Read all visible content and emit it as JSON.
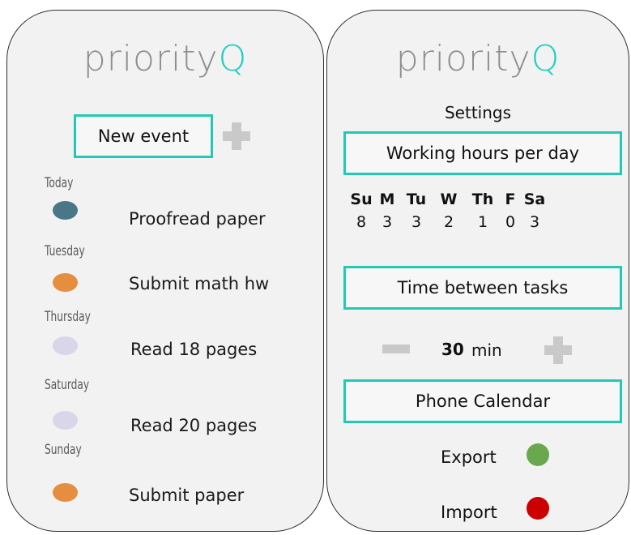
{
  "colors": {
    "accent": "#23c9b4",
    "logo_gray": "#8f8f8f",
    "plus_gray": "#c9c9c9",
    "export_green": "#6aa84f",
    "import_red": "#cc0000"
  },
  "left": {
    "logo": {
      "main": "priority",
      "accent": "Q"
    },
    "new_event_label": "New event",
    "add_icon": "plus-icon",
    "events": [
      {
        "day": "Today",
        "task": "Proofread paper",
        "color": "#4a7787"
      },
      {
        "day": "Tuesday",
        "task": "Submit math hw",
        "color": "#e58e3f"
      },
      {
        "day": "Thursday",
        "task": "Read 18 pages",
        "color": "#d9d6ea"
      },
      {
        "day": "Saturday",
        "task": "Read 20 pages",
        "color": "#d9d6ea"
      },
      {
        "day": "Sunday",
        "task": "Submit paper",
        "color": "#e58e3f"
      }
    ]
  },
  "right": {
    "logo": {
      "main": "priority",
      "accent": "Q"
    },
    "settings_title": "Settings",
    "working_hours_label": "Working hours per day",
    "weekdays": [
      {
        "label": "Su",
        "hours": "8"
      },
      {
        "label": "M",
        "hours": "3"
      },
      {
        "label": "Tu",
        "hours": "3"
      },
      {
        "label": "W",
        "hours": "2"
      },
      {
        "label": "Th",
        "hours": "1"
      },
      {
        "label": "F",
        "hours": "0"
      },
      {
        "label": "Sa",
        "hours": "3"
      }
    ],
    "time_between_label": "Time between tasks",
    "time_between_value": "30",
    "time_between_unit": "min",
    "phone_calendar_label": "Phone Calendar",
    "export_label": "Export",
    "import_label": "Import"
  }
}
